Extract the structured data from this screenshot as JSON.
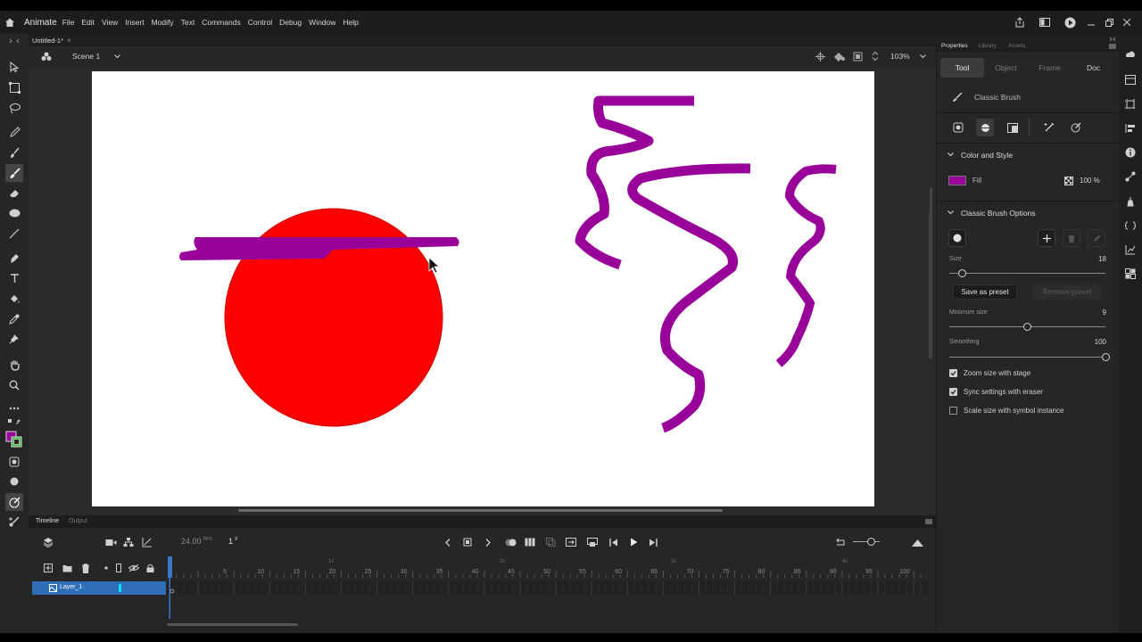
{
  "app": {
    "name": "Animate",
    "menu": [
      "File",
      "Edit",
      "View",
      "Insert",
      "Modify",
      "Text",
      "Commands",
      "Control",
      "Debug",
      "Window",
      "Help"
    ]
  },
  "document": {
    "tab_title": "Untitled-1*",
    "scene": "Scene 1",
    "zoom": "103%"
  },
  "timeline": {
    "tabs": [
      "Timeline",
      "Output"
    ],
    "fps": "24.00",
    "fps_unit": "FPS",
    "current_frame": "1",
    "frame_unit": "F",
    "ruler_numbers": [
      "5",
      "10",
      "15",
      "20",
      "25",
      "30",
      "35",
      "40",
      "45",
      "50",
      "55",
      "60",
      "65",
      "70",
      "75",
      "80",
      "85",
      "90",
      "95",
      "100",
      "105"
    ],
    "ruler_seconds": [
      "1s",
      "2s",
      "3s",
      "4s"
    ],
    "layer_name": "Layer_1"
  },
  "panel": {
    "tabs": [
      "Properties",
      "Library",
      "Assets"
    ],
    "subtabs": [
      "Tool",
      "Object",
      "Frame",
      "Doc"
    ],
    "active_subtab": "Tool",
    "tool_name": "Classic Brush",
    "color_style": {
      "header": "Color and Style",
      "fill_label": "Fill",
      "fill_color": "#990099",
      "alpha": "100 %"
    },
    "brush_options": {
      "header": "Classic Brush Options",
      "size_label": "Size",
      "size_value": "18",
      "size_level": 0.08,
      "save_preset": "Save as preset",
      "remove_preset": "Remove preset",
      "min_size_label": "Minimum size",
      "min_size_value": "9",
      "min_size_level": 0.5,
      "smoothing_label": "Smoothing",
      "smoothing_value": "100",
      "smoothing_level": 1.0,
      "checkboxes": [
        {
          "label": "Zoom size with stage",
          "checked": true
        },
        {
          "label": "Sync settings with eraser",
          "checked": true
        },
        {
          "label": "Scale size with symbol instance",
          "checked": false
        }
      ]
    }
  },
  "stage_colors": {
    "circle": "#ff0000",
    "stroke": "#990099",
    "background": "#ffffff"
  }
}
